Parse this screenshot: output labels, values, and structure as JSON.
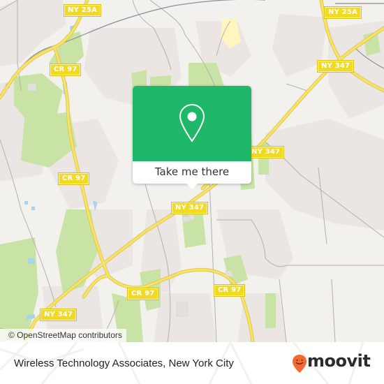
{
  "map": {
    "road_labels": [
      {
        "id": "ny25a-left",
        "text": "NY 25A"
      },
      {
        "id": "ny25a-right",
        "text": "NY 25A"
      },
      {
        "id": "cr97-top",
        "text": "CR 97"
      },
      {
        "id": "ny347-right",
        "text": "NY 347"
      },
      {
        "id": "ny347-center",
        "text": "NY 347"
      },
      {
        "id": "cr97-left",
        "text": "CR 97"
      },
      {
        "id": "cr97-bottom-center",
        "text": "CR 97"
      },
      {
        "id": "cr97-bottom-right",
        "text": "CR 97"
      },
      {
        "id": "ny347-bottom-left",
        "text": "NY 347"
      }
    ],
    "attribution": "© OpenStreetMap contributors",
    "colors": {
      "land": "#f2f1ee",
      "residential": "#ebe6e3",
      "park": "#c9e3a6",
      "water": "#a9d3ea",
      "road": "#f7e36a",
      "road_casing": "#e0c94a",
      "minor_road": "#b5b0ab",
      "rail": "#8c8c8c",
      "shield_bg": "#f0da26"
    }
  },
  "popup": {
    "icon": "map-pin-icon",
    "button_label": "Take me there",
    "color": "#1fb868"
  },
  "footer": {
    "place_name": "Wireless Technology Associates, New York City",
    "brand": "moovit",
    "brand_icon": "moovit-smile-pin-icon",
    "brand_color": "#f26a31"
  }
}
